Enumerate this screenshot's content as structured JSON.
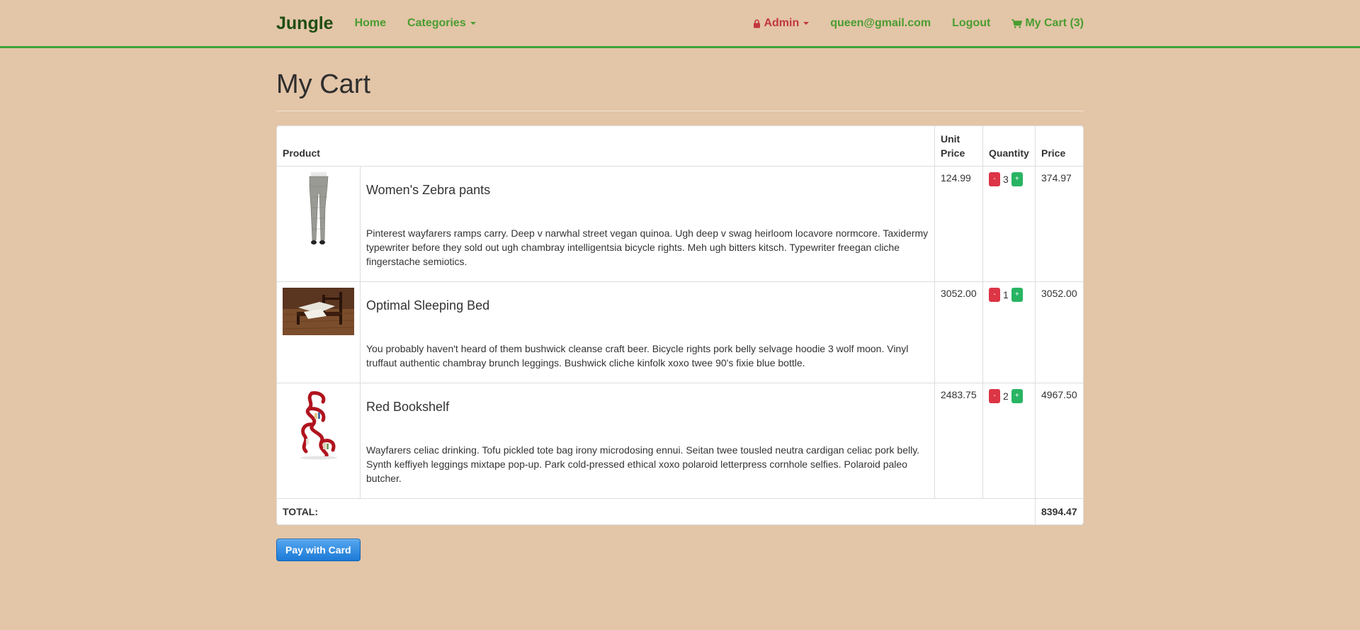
{
  "nav": {
    "brand": "Jungle",
    "home": "Home",
    "categories": "Categories",
    "admin": "Admin",
    "email": "queen@gmail.com",
    "logout": "Logout",
    "cart": "My Cart (3)"
  },
  "page": {
    "title": "My Cart"
  },
  "table": {
    "headers": {
      "product": "Product",
      "unit_price": "Unit Price",
      "quantity": "Quantity",
      "price": "Price"
    },
    "items": [
      {
        "name": "Women's Zebra pants",
        "description": "Pinterest wayfarers ramps carry. Deep v narwhal street vegan quinoa. Ugh deep v swag heirloom locavore normcore. Taxidermy typewriter before they sold out ugh chambray intelligentsia bicycle rights. Meh ugh bitters kitsch. Typewriter freegan cliche fingerstache semiotics.",
        "unit_price": "124.99",
        "quantity": "3",
        "price": "374.97",
        "minus": "-",
        "plus": "+"
      },
      {
        "name": "Optimal Sleeping Bed",
        "description": "You probably haven't heard of them bushwick cleanse craft beer. Bicycle rights pork belly selvage hoodie 3 wolf moon. Vinyl truffaut authentic chambray brunch leggings. Bushwick cliche kinfolk xoxo twee 90's fixie blue bottle.",
        "unit_price": "3052.00",
        "quantity": "1",
        "price": "3052.00",
        "minus": "-",
        "plus": "+"
      },
      {
        "name": "Red Bookshelf",
        "description": "Wayfarers celiac drinking. Tofu pickled tote bag irony microdosing ennui. Seitan twee tousled neutra cardigan celiac pork belly. Synth keffiyeh leggings mixtape pop-up. Park cold-pressed ethical xoxo polaroid letterpress cornhole selfies. Polaroid paleo butcher.",
        "unit_price": "2483.75",
        "quantity": "2",
        "price": "4967.50",
        "minus": "-",
        "plus": "+"
      }
    ],
    "total_label": "TOTAL:",
    "total_value": "8394.47"
  },
  "pay_button": "Pay with Card",
  "colors": {
    "background": "#e3c5a8",
    "nav_link": "#4a9d30",
    "brand": "#1f4d12",
    "admin": "#c2363c",
    "nav_border": "#3ea33a",
    "minus_button": "#dc3545",
    "plus_button": "#28b463",
    "pay_button": "#1c7ad6"
  },
  "icons": {
    "admin": "lock-icon",
    "cart": "shopping-cart-icon",
    "dropdown": "caret-down-icon"
  }
}
